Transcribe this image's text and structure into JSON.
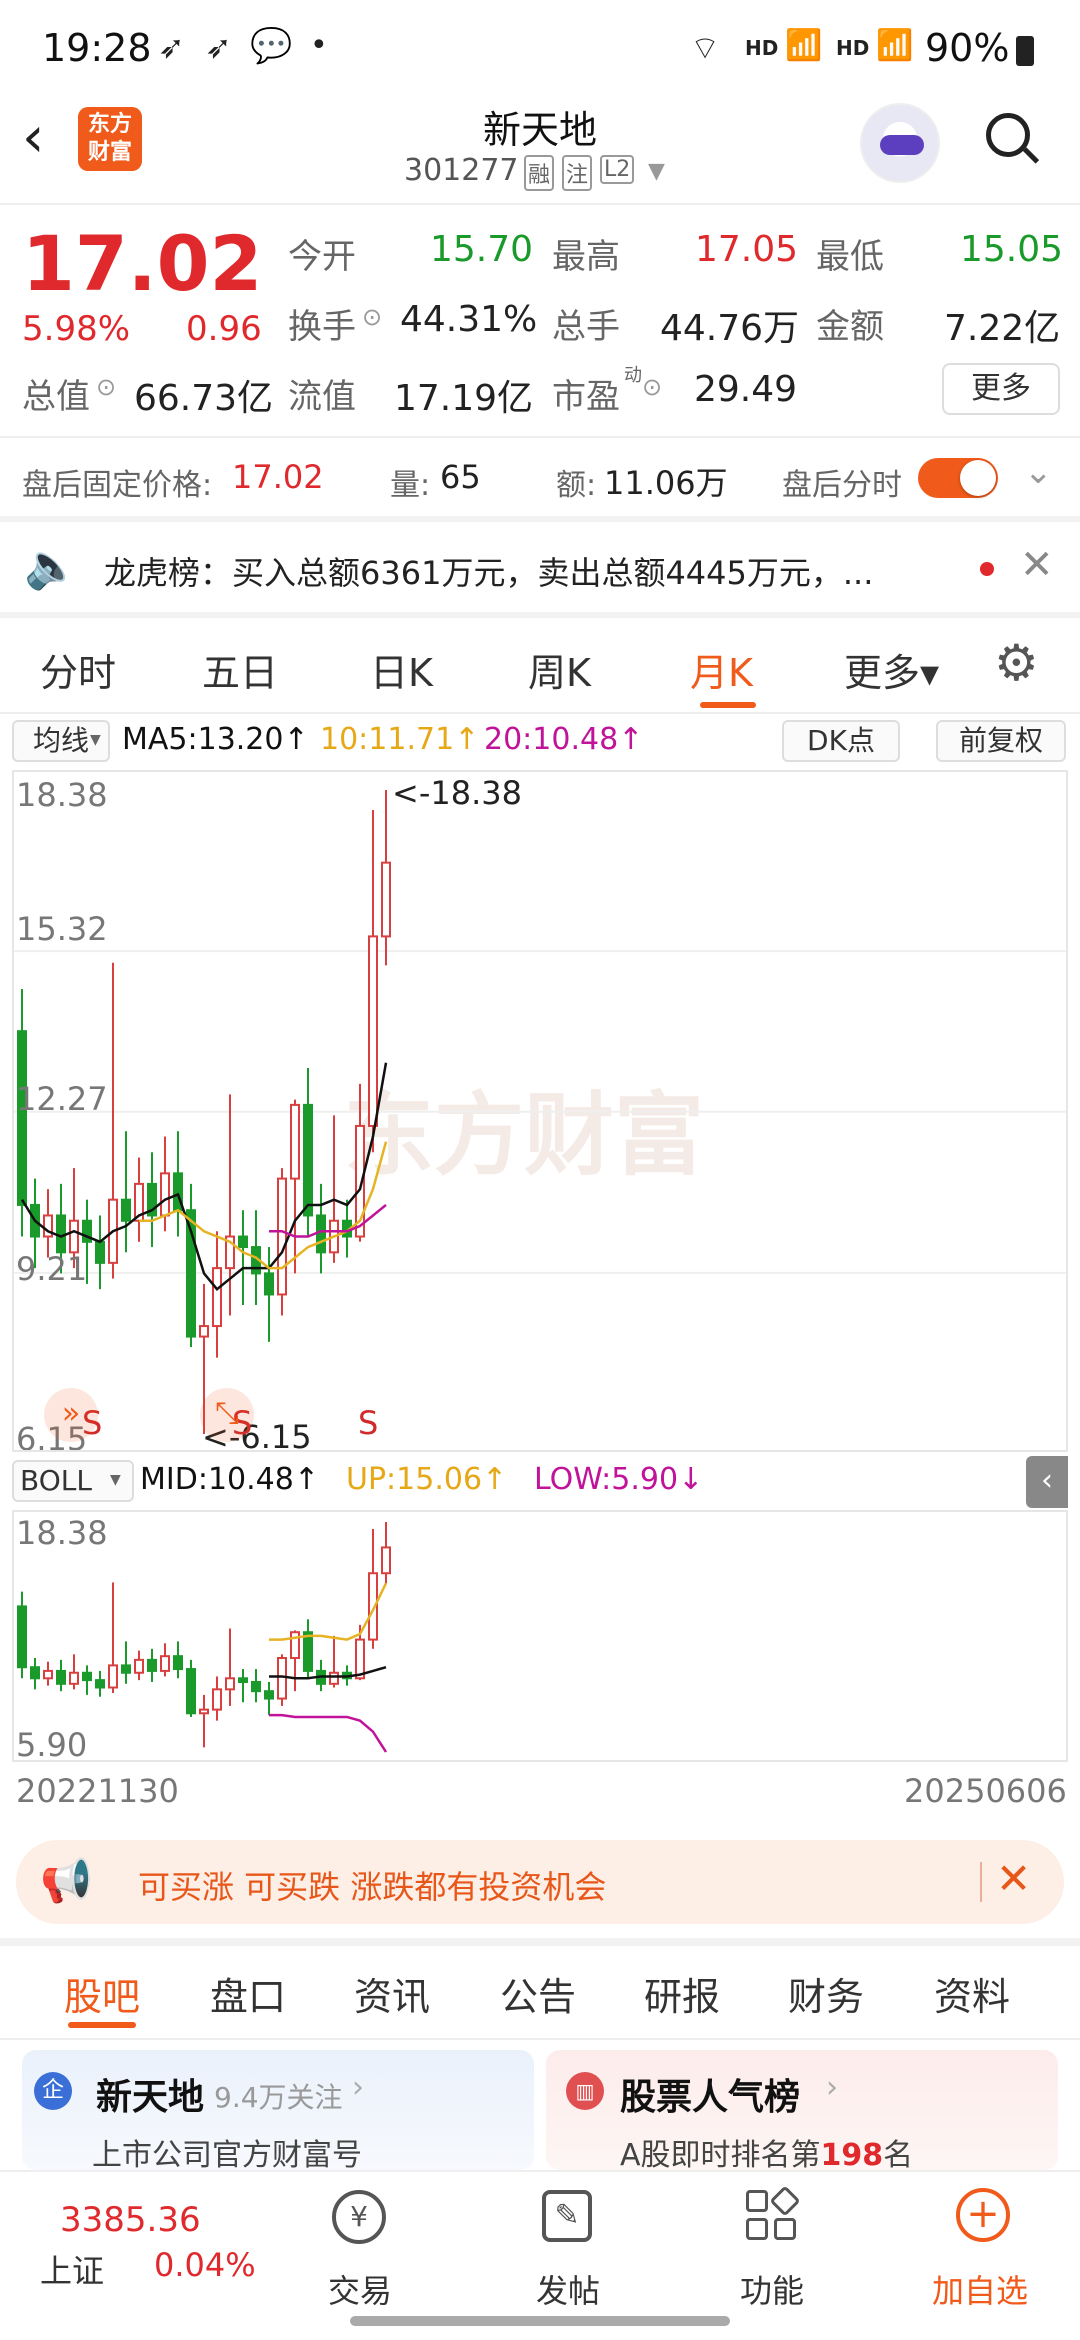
{
  "status_bar": {
    "time": "19:28",
    "network1": "HD",
    "network2": "HD",
    "battery": "90%"
  },
  "header": {
    "logo_text": "东方财富",
    "title": "新天地",
    "code": "301277",
    "tag1": "融",
    "tag2": "注",
    "tag3": "L2"
  },
  "quote": {
    "price": "17.02",
    "change_pct": "5.98%",
    "change": "0.96",
    "open_label": "今开",
    "open": "15.70",
    "high_label": "最高",
    "high": "17.05",
    "low_label": "最低",
    "low": "15.05",
    "turnover_label": "换手",
    "turnover": "44.31%",
    "volume_label": "总手",
    "volume": "44.76万",
    "amount_label": "金额",
    "amount": "7.22亿",
    "mktcap_label": "总值",
    "mktcap": "66.73亿",
    "float_label": "流值",
    "float": "17.19亿",
    "pe_label": "市盈",
    "pe_sup": "动",
    "pe": "29.49",
    "more": "更多"
  },
  "after_hours": {
    "price_label": "盘后固定价格:",
    "price": "17.02",
    "vol_label": "量:",
    "vol": "65",
    "amt_label": "额:",
    "amt": "11.06万",
    "toggle_label": "盘后分时"
  },
  "notice": {
    "text": "龙虎榜：买入总额6361万元，卖出总额4445万元，..."
  },
  "chart_tabs": [
    "分时",
    "五日",
    "日K",
    "周K",
    "月K",
    "更多▾"
  ],
  "ma_bar": {
    "selector": "均线",
    "ma5": "MA5:13.20↑",
    "ma10": "10:11.71↑",
    "ma20": "20:10.48↑",
    "dk": "DK点",
    "adjust": "前复权"
  },
  "boll_bar": {
    "selector": "BOLL",
    "mid": "MID:10.48↑",
    "up": "UP:15.06↑",
    "low": "LOW:5.90↓"
  },
  "chart_data": {
    "type": "candlestick",
    "main_axis_labels": [
      "18.38",
      "15.32",
      "12.27",
      "9.21",
      "6.15"
    ],
    "max_label": "<-18.38",
    "min_label": "<-6.15",
    "signals": [
      "S",
      "S",
      "S"
    ],
    "sub_axis_labels": [
      "18.38",
      "5.90"
    ],
    "start_date": "20221130",
    "end_date": "20250606",
    "watermark": "东方财富"
  },
  "promo": {
    "text": "可买涨 可买跌 涨跌都有投资机会"
  },
  "bottom_tabs": [
    "股吧",
    "盘口",
    "资讯",
    "公告",
    "研报",
    "财务",
    "资料"
  ],
  "cards": {
    "left_title": "新天地",
    "left_sub": "9.4万关注",
    "left_desc": "上市公司官方财富号",
    "left_badge": "企",
    "right_title": "股票人气榜",
    "right_desc_prefix": "A股即时排名第",
    "right_rank": "198",
    "right_desc_suffix": "名"
  },
  "bottom_nav": {
    "index_value": "3385.36",
    "index_name": "上证",
    "index_change": "0.04%",
    "trade": "交易",
    "post": "发帖",
    "func": "功能",
    "add": "加自选"
  }
}
